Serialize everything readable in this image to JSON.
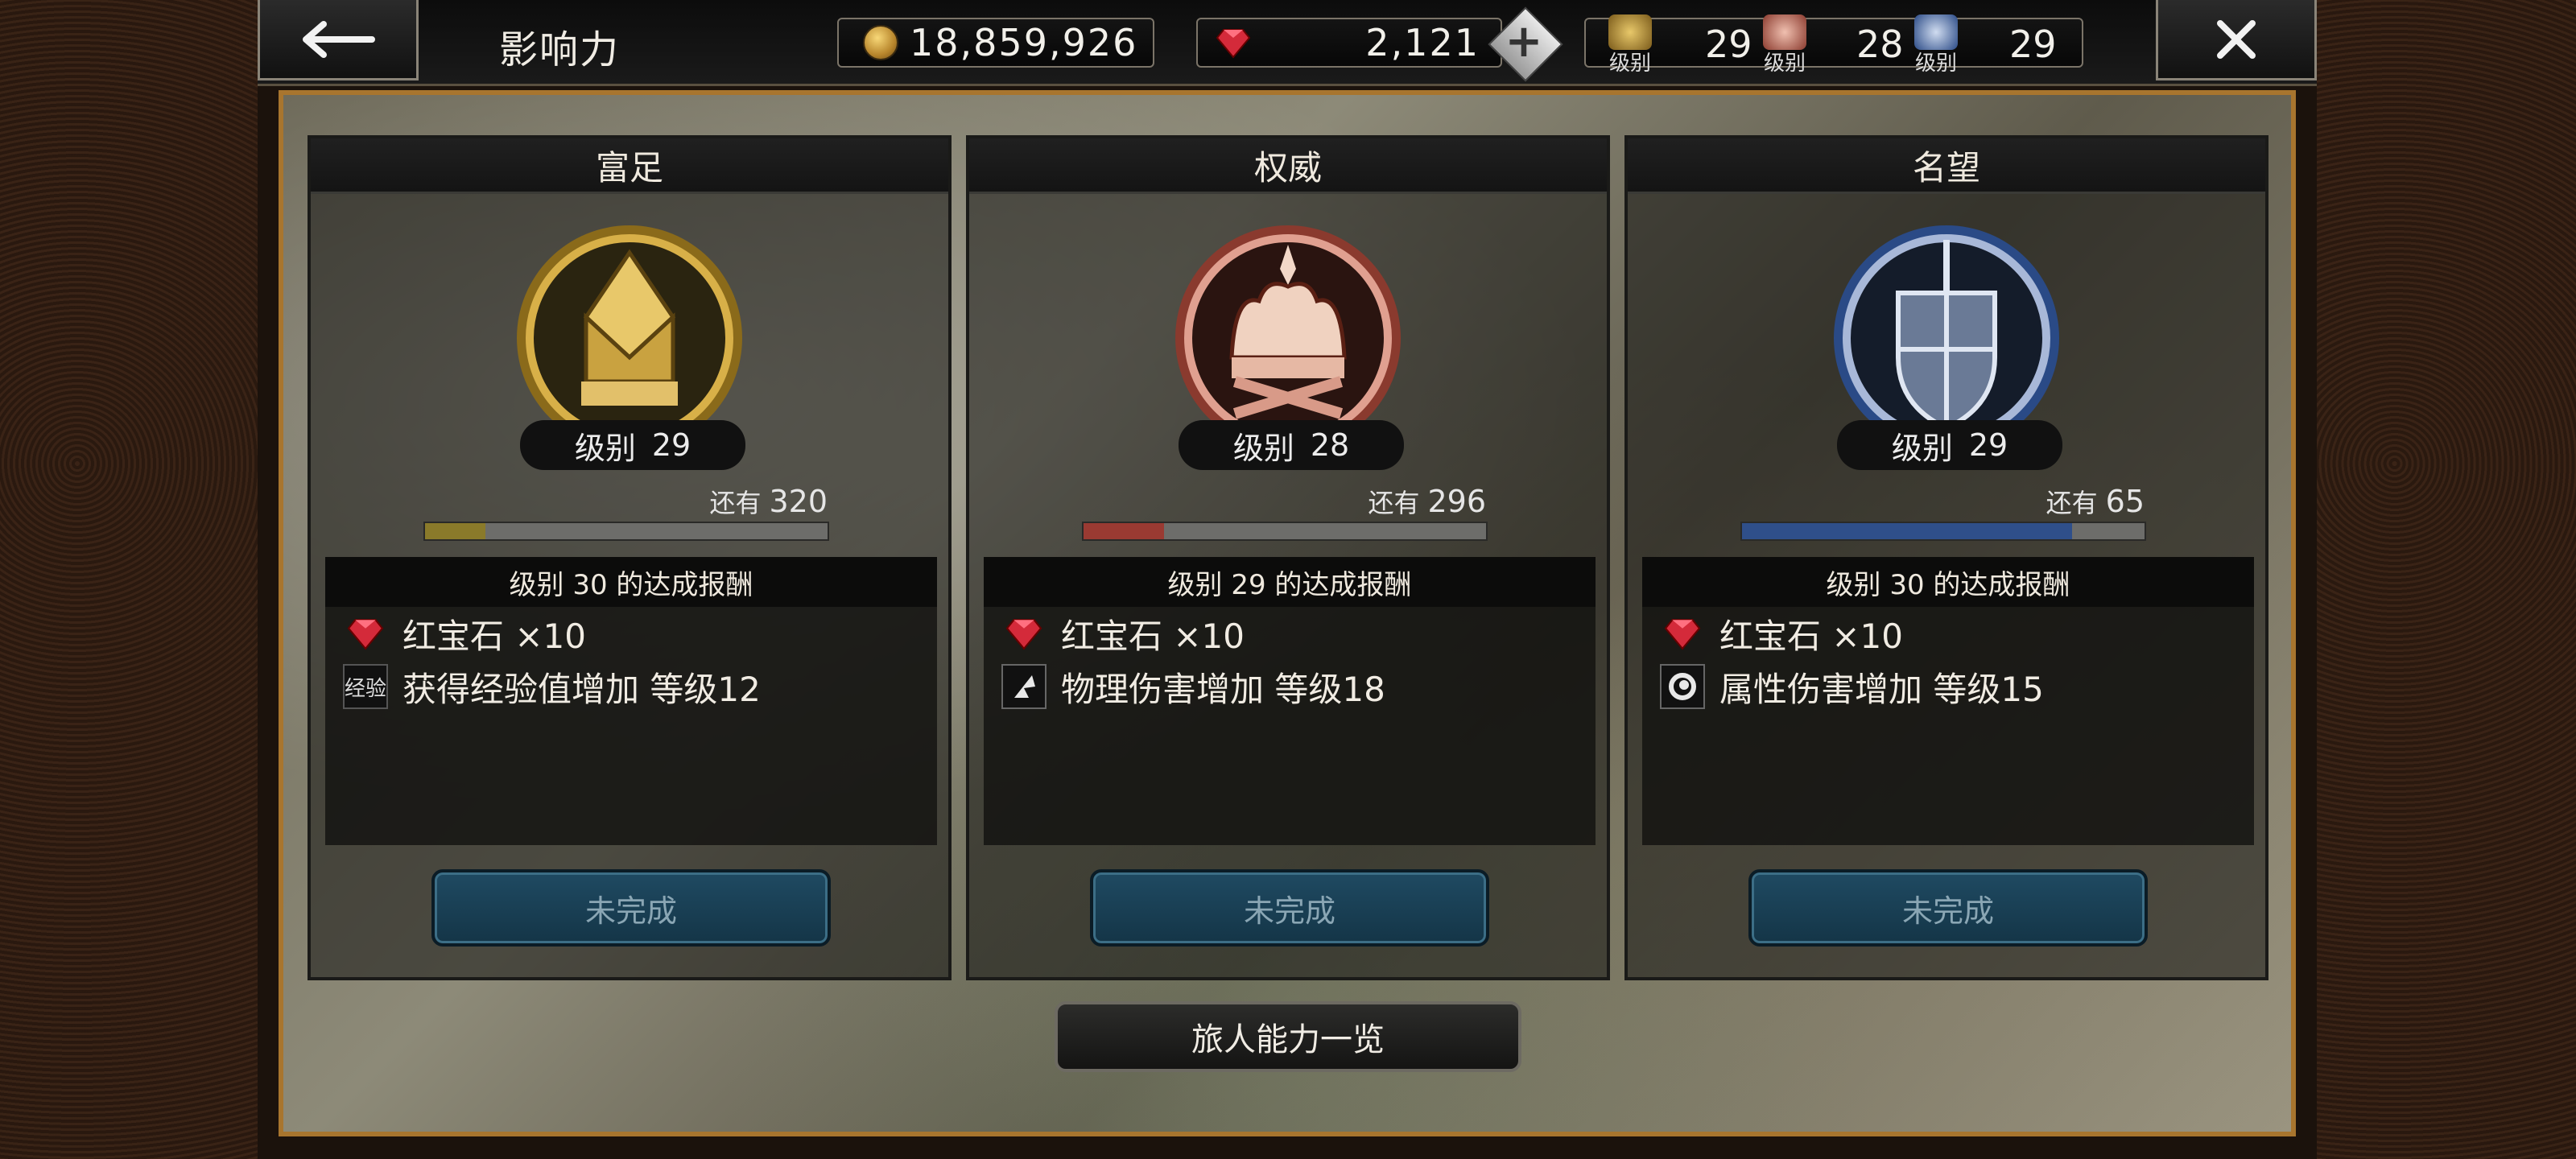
{
  "header": {
    "title": "影响力",
    "gold": "18,859,926",
    "rubies": "2,121",
    "levels": [
      {
        "icon": "wealth-level-icon",
        "sub": "级别",
        "value": "29"
      },
      {
        "icon": "power-level-icon",
        "sub": "级别",
        "value": "28"
      },
      {
        "icon": "fame-level-icon",
        "sub": "级别",
        "value": "29"
      }
    ]
  },
  "panels": [
    {
      "name": "富足",
      "level_label": "级别",
      "level": "29",
      "remain_label": "还有",
      "remain": "320",
      "progress": 0.15,
      "bar_color": "#8a7a2a",
      "reward_title": "级别 30 的达成报酬",
      "rewards": [
        {
          "icon": "ruby-icon",
          "text": "红宝石 ×10"
        },
        {
          "icon": "exp-icon",
          "icon_label": "经验",
          "text": "获得经验值增加 等级12"
        }
      ],
      "status": "未完成"
    },
    {
      "name": "权威",
      "level_label": "级别",
      "level": "28",
      "remain_label": "还有",
      "remain": "296",
      "progress": 0.2,
      "bar_color": "#9a3a32",
      "reward_title": "级别 29 的达成报酬",
      "rewards": [
        {
          "icon": "ruby-icon",
          "text": "红宝石 ×10"
        },
        {
          "icon": "physical-attack-icon",
          "text": "物理伤害增加 等级18"
        }
      ],
      "status": "未完成"
    },
    {
      "name": "名望",
      "level_label": "级别",
      "level": "29",
      "remain_label": "还有",
      "remain": "65",
      "progress": 0.82,
      "bar_color": "#2f4f8a",
      "reward_title": "级别 30 的达成报酬",
      "rewards": [
        {
          "icon": "ruby-icon",
          "text": "红宝石 ×10"
        },
        {
          "icon": "elemental-attack-icon",
          "text": "属性伤害增加 等级15"
        }
      ],
      "status": "未完成"
    }
  ],
  "footer": {
    "button": "旅人能力一览"
  }
}
